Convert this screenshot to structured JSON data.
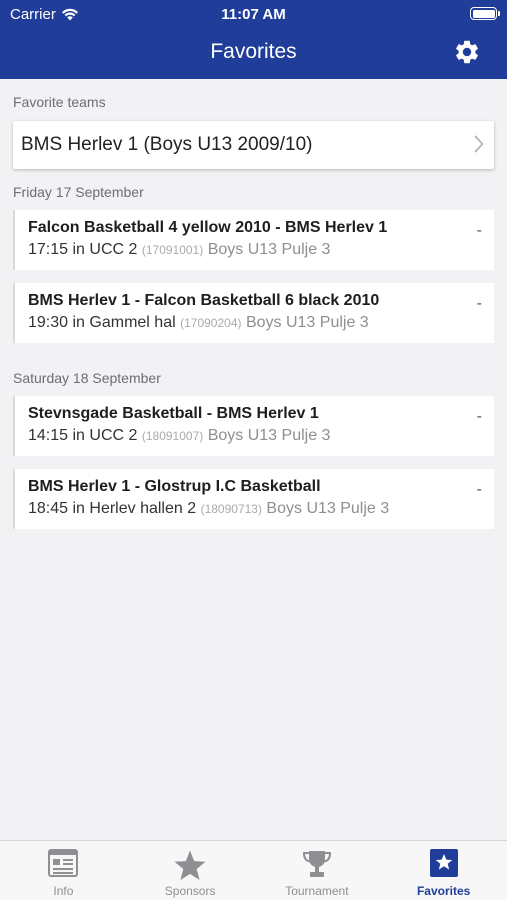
{
  "status_bar": {
    "carrier": "Carrier",
    "time": "11:07 AM"
  },
  "nav": {
    "title": "Favorites"
  },
  "favorite_teams": {
    "label": "Favorite teams",
    "teams": [
      {
        "name": "BMS Herlev 1 (Boys U13 2009/10)"
      }
    ]
  },
  "days": [
    {
      "label": "Friday 17 September",
      "matches": [
        {
          "title": "Falcon Basketball 4 yellow 2010 - BMS Herlev 1",
          "time": "17:15",
          "venue": "in UCC 2",
          "code": "(17091001)",
          "pool": "Boys U13 Pulje 3",
          "score": "-"
        },
        {
          "title": "BMS Herlev 1 - Falcon Basketball 6 black 2010",
          "time": "19:30",
          "venue": "in Gammel hal",
          "code": "(17090204)",
          "pool": "Boys U13 Pulje 3",
          "score": "-"
        }
      ]
    },
    {
      "label": "Saturday 18 September",
      "matches": [
        {
          "title": "Stevnsgade Basketball - BMS Herlev 1",
          "time": "14:15",
          "venue": "in UCC 2",
          "code": "(18091007)",
          "pool": "Boys U13 Pulje 3",
          "score": "-"
        },
        {
          "title": "BMS Herlev 1 - Glostrup I.C Basketball",
          "time": "18:45",
          "venue": "in Herlev hallen 2",
          "code": "(18090713)",
          "pool": "Boys U13 Pulje 3",
          "score": "-"
        }
      ]
    }
  ],
  "tabbar": {
    "tabs": [
      {
        "label": "Info",
        "icon": "news-icon"
      },
      {
        "label": "Sponsors",
        "icon": "star-icon"
      },
      {
        "label": "Tournament",
        "icon": "trophy-icon"
      },
      {
        "label": "Favorites",
        "icon": "star-box-icon",
        "active": true
      }
    ]
  },
  "colors": {
    "brand": "#1f3d99",
    "tab_inactive": "#8e8e93"
  }
}
